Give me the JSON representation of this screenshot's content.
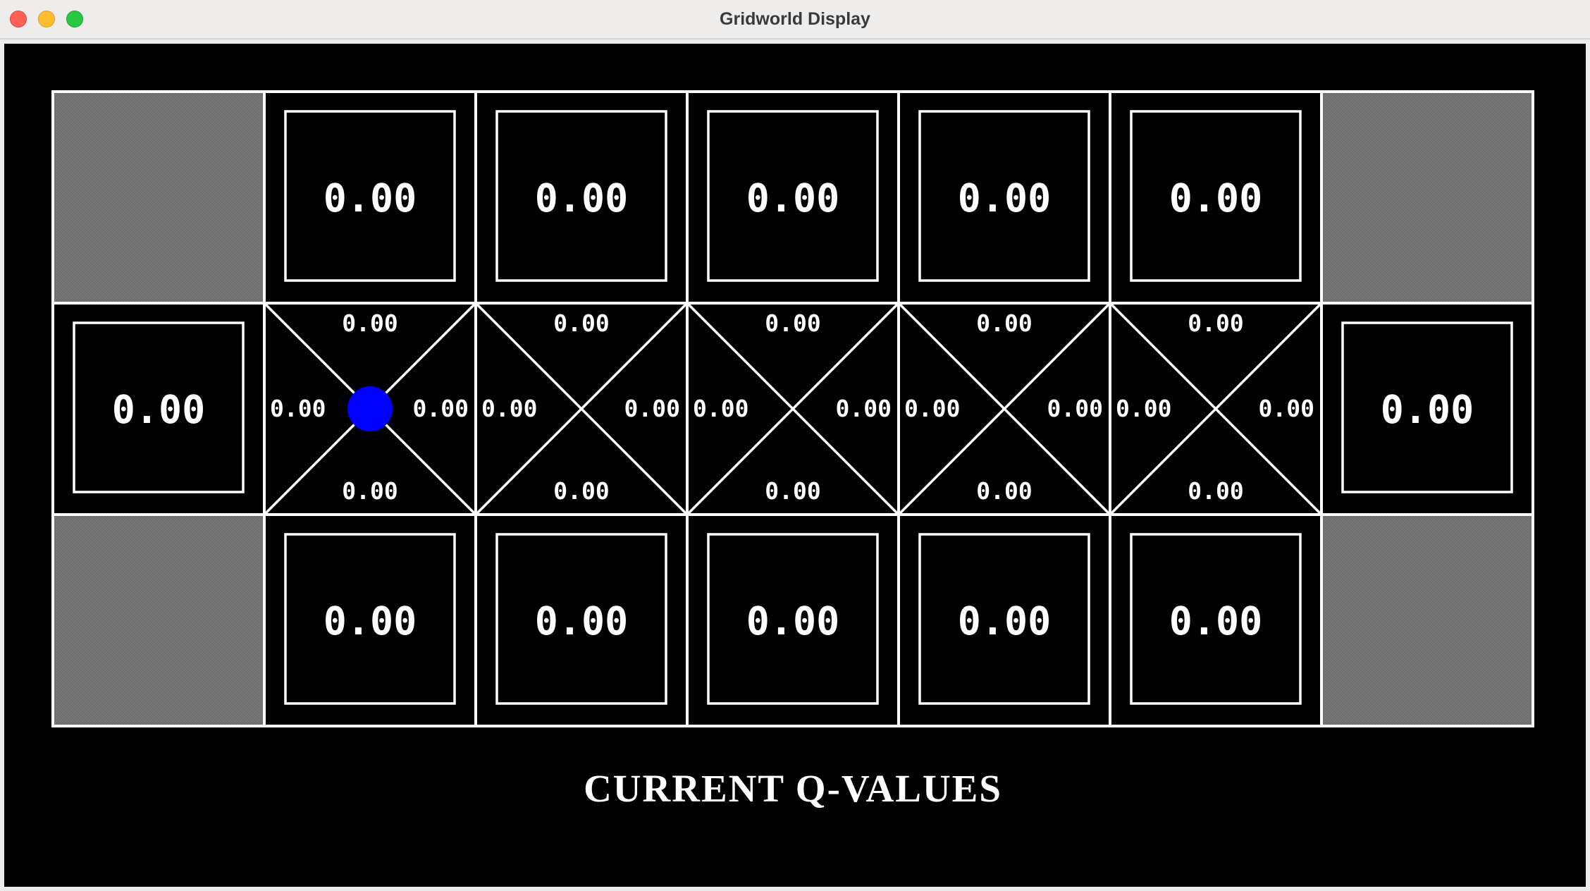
{
  "window": {
    "title": "Gridworld Display",
    "controls": [
      "close",
      "minimize",
      "zoom"
    ]
  },
  "colors": {
    "background": "#000000",
    "wall": "#777777",
    "grid_line": "#ffffff",
    "agent": "#0000ff",
    "text": "#ffffff"
  },
  "caption": "CURRENT Q-VALUES",
  "grid": {
    "rows": 3,
    "cols": 7,
    "cells": [
      {
        "row": 0,
        "col": 0,
        "type": "wall"
      },
      {
        "row": 0,
        "col": 1,
        "type": "value",
        "value": "0.00"
      },
      {
        "row": 0,
        "col": 2,
        "type": "value",
        "value": "0.00"
      },
      {
        "row": 0,
        "col": 3,
        "type": "value",
        "value": "0.00"
      },
      {
        "row": 0,
        "col": 4,
        "type": "value",
        "value": "0.00"
      },
      {
        "row": 0,
        "col": 5,
        "type": "value",
        "value": "0.00"
      },
      {
        "row": 0,
        "col": 6,
        "type": "wall"
      },
      {
        "row": 1,
        "col": 0,
        "type": "value",
        "value": "0.00"
      },
      {
        "row": 1,
        "col": 1,
        "type": "qvalues",
        "north": "0.00",
        "east": "0.00",
        "south": "0.00",
        "west": "0.00",
        "agent": true
      },
      {
        "row": 1,
        "col": 2,
        "type": "qvalues",
        "north": "0.00",
        "east": "0.00",
        "south": "0.00",
        "west": "0.00"
      },
      {
        "row": 1,
        "col": 3,
        "type": "qvalues",
        "north": "0.00",
        "east": "0.00",
        "south": "0.00",
        "west": "0.00"
      },
      {
        "row": 1,
        "col": 4,
        "type": "qvalues",
        "north": "0.00",
        "east": "0.00",
        "south": "0.00",
        "west": "0.00"
      },
      {
        "row": 1,
        "col": 5,
        "type": "qvalues",
        "north": "0.00",
        "east": "0.00",
        "south": "0.00",
        "west": "0.00"
      },
      {
        "row": 1,
        "col": 6,
        "type": "value",
        "value": "0.00"
      },
      {
        "row": 2,
        "col": 0,
        "type": "wall"
      },
      {
        "row": 2,
        "col": 1,
        "type": "value",
        "value": "0.00"
      },
      {
        "row": 2,
        "col": 2,
        "type": "value",
        "value": "0.00"
      },
      {
        "row": 2,
        "col": 3,
        "type": "value",
        "value": "0.00"
      },
      {
        "row": 2,
        "col": 4,
        "type": "value",
        "value": "0.00"
      },
      {
        "row": 2,
        "col": 5,
        "type": "value",
        "value": "0.00"
      },
      {
        "row": 2,
        "col": 6,
        "type": "wall"
      }
    ]
  }
}
